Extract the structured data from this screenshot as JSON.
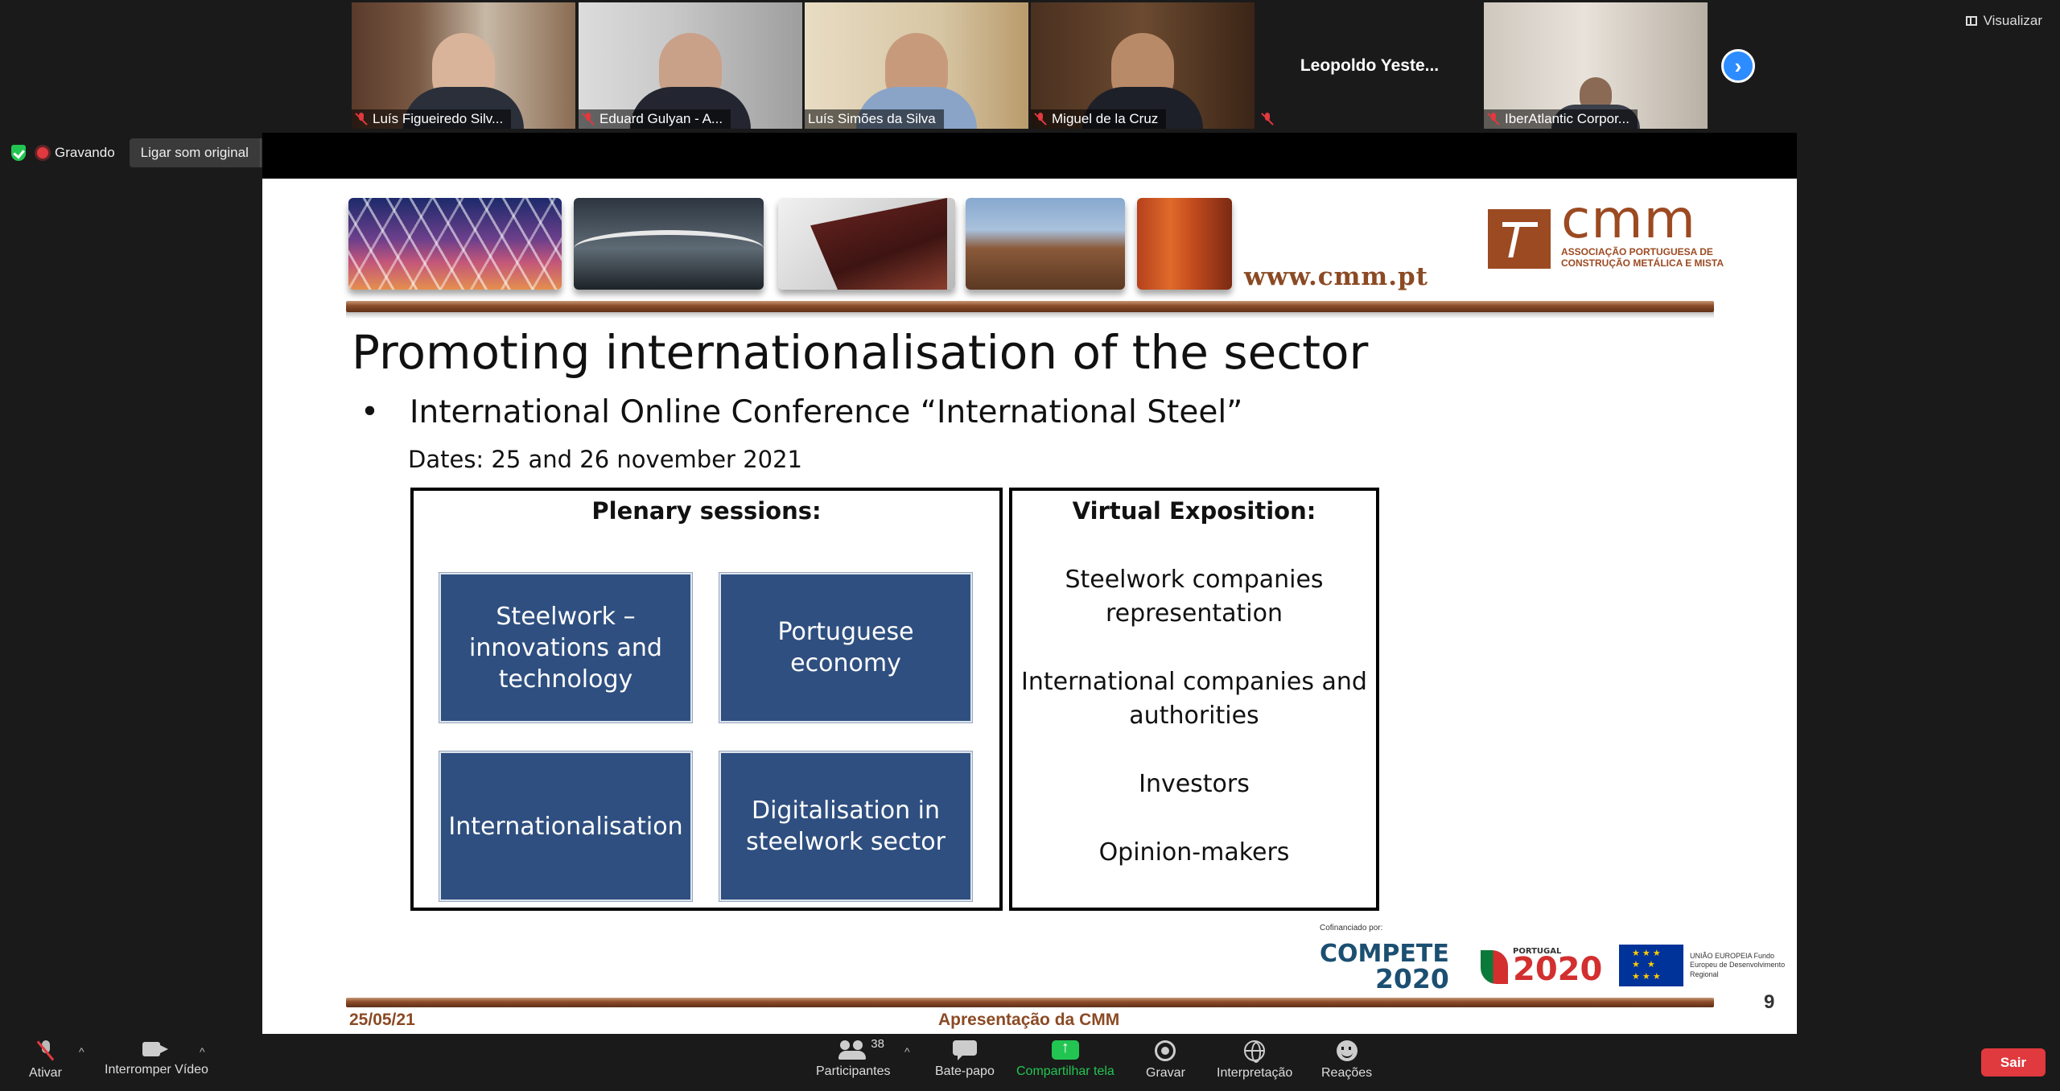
{
  "participants": [
    {
      "name": "Luís Figueiredo Silv...",
      "muted": true,
      "active": false
    },
    {
      "name": "Eduard Gulyan - A...",
      "muted": true,
      "active": false
    },
    {
      "name": "Luís Simões da Silva",
      "muted": false,
      "active": true
    },
    {
      "name": "Miguel de la Cruz",
      "muted": true,
      "active": false
    },
    {
      "name": "Leopoldo  Yeste...",
      "muted": true,
      "active": false,
      "video_off": true
    },
    {
      "name": "IberAtlantic Corpor...",
      "muted": true,
      "active": false
    }
  ],
  "view_label": "Visualizar",
  "recording": {
    "label": "Gravando",
    "original_sound_label": "Ligar som original"
  },
  "slide": {
    "website": "www.cmm.pt",
    "logo_word": "cmm",
    "logo_subtitle": "ASSOCIAÇÃO PORTUGUESA DE CONSTRUÇÃO METÁLICA E MISTA",
    "title": "Promoting internationalisation of the sector",
    "bullet": "International Online Conference “International Steel”",
    "dates": "Dates: 25 and 26 november 2021",
    "plenary": {
      "heading": "Plenary sessions:",
      "tiles": [
        "Steelwork – innovations and technology",
        "Portuguese economy",
        "Internationalisation",
        "Digitalisation in steelwork sector"
      ]
    },
    "expo": {
      "heading": "Virtual Exposition:",
      "items": [
        "Steelwork companies representation",
        "International companies and authorities",
        "Investors",
        "Opinion-makers"
      ]
    },
    "cofinanced_label": "Cofinanciado por:",
    "compete_text": "COMPETE",
    "compete_num": "2020",
    "portugal_small": "PORTUGAL",
    "portugal_num": "2020",
    "eu_text": "UNIÃO EUROPEIA Fundo Europeu de Desenvolvimento Regional",
    "footer_date": "25/05/21",
    "footer_title": "Apresentação da CMM",
    "page_number": "9"
  },
  "toolbar": {
    "mute_label": "Ativar",
    "video_label": "Interromper Vídeo",
    "participants_label": "Participantes",
    "participants_count": "38",
    "chat_label": "Bate-papo",
    "share_label": "Compartilhar tela",
    "record_label": "Gravar",
    "interpretation_label": "Interpretação",
    "reactions_label": "Reações",
    "leave_label": "Sair"
  },
  "colors": {
    "accent_blue": "#2d8cff",
    "share_green": "#23c552",
    "leave_red": "#e0393e",
    "tile_blue": "#2f4f80",
    "cmm_brown": "#9c4a22"
  }
}
